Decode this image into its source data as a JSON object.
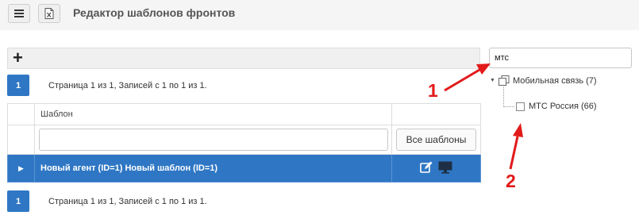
{
  "header": {
    "title": "Редактор шаблонов фронтов"
  },
  "toolbar": {
    "add_label": "+"
  },
  "pager": {
    "page": "1",
    "summary": "Страница 1 из 1, Записей с 1 по 1 из 1."
  },
  "grid": {
    "column_header": "Шаблон",
    "filter_placeholder": "",
    "all_templates_button": "Все шаблоны",
    "rows": [
      {
        "title": "Новый агент (ID=1) Новый шаблон (ID=1)"
      }
    ]
  },
  "search": {
    "value": "мтс"
  },
  "tree": {
    "root_label": "Мобильная связь (7)",
    "child_label": "МТС Россия (66)"
  },
  "annotations": {
    "label_1": "1",
    "label_2": "2",
    "color": "#e21a1a"
  },
  "colors": {
    "accent": "#2f77c4",
    "topbar": "#f5f5f5"
  }
}
